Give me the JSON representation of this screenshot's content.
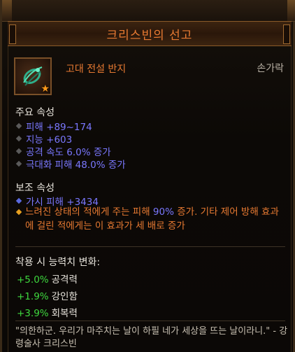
{
  "item": {
    "name": "크리스빈의 선고",
    "type": "고대 전설 반지",
    "slot": "손가락",
    "icon": "green-ring-icon",
    "badge_icon": "ancient-star-icon"
  },
  "primary": {
    "heading": "주요 속성",
    "stats": [
      "피해 +89~174",
      "지능 +603",
      "공격 속도 6.0% 증가",
      "극대화 피해 48.0% 증가"
    ]
  },
  "secondary": {
    "heading": "보조 속성",
    "stats": [
      "가시 피해 +3434"
    ],
    "legendary_parts": [
      "느려진 상태의 적에게 주는 피해 ",
      "90%",
      " 증가. 기타 제어 방해 효과에 걸린 적에게는 이 효과가 세 배로 증가"
    ]
  },
  "equip": {
    "heading": "착용 시 능력치 변화:",
    "changes": [
      {
        "value": "+5.0%",
        "label": "공격력"
      },
      {
        "value": "+1.9%",
        "label": "강인함"
      },
      {
        "value": "+3.9%",
        "label": "회복력"
      }
    ]
  },
  "flavor": "\"의한하군. 우리가 마주치는 날이 하필 네가 세상을 뜨는 날이라니.\" - 강령술사 크리스빈",
  "colors": {
    "legendary": "#e87a32",
    "magic": "#7a78ff",
    "positive": "#3ed83e",
    "white": "#e8e4dc"
  }
}
